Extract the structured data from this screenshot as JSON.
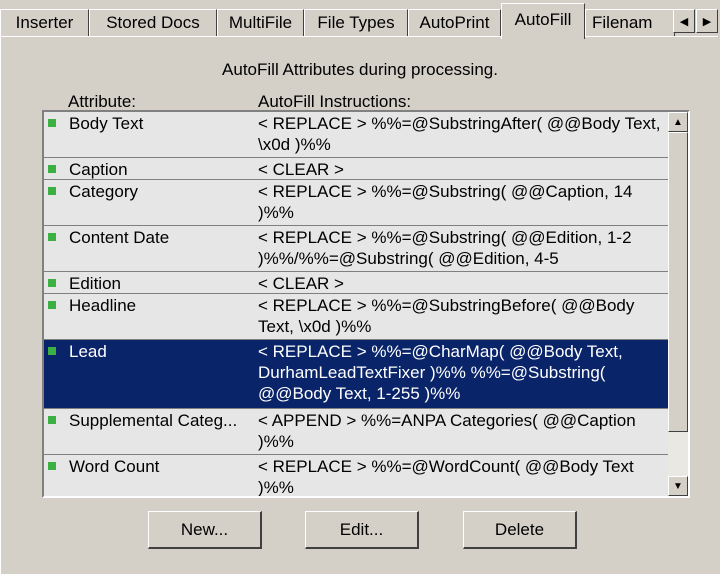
{
  "tabs": [
    {
      "label": "Inserter"
    },
    {
      "label": "Stored Docs"
    },
    {
      "label": "MultiFile"
    },
    {
      "label": "File Types"
    },
    {
      "label": "AutoPrint"
    },
    {
      "label": "AutoFill"
    },
    {
      "label": "Filenam"
    }
  ],
  "active_tab": "AutoFill",
  "tab_scroll": {
    "left_icon": "arrow-left-icon",
    "right_icon": "arrow-right-icon"
  },
  "panel": {
    "heading": "AutoFill Attributes during processing.",
    "columns": {
      "attribute": "Attribute:",
      "instructions": "AutoFill Instructions:"
    }
  },
  "rows": [
    {
      "attribute": "Body Text",
      "instructions": "< REPLACE > %%=@SubstringAfter( @@Body Text, \\x0d )%%",
      "selected": false
    },
    {
      "attribute": "Caption",
      "instructions": "< CLEAR >",
      "selected": false
    },
    {
      "attribute": "Category",
      "instructions": "< REPLACE > %%=@Substring( @@Caption, 14 )%%",
      "selected": false
    },
    {
      "attribute": "Content Date",
      "instructions": "< REPLACE > %%=@Substring( @@Edition, 1-2 )%%/%%=@Substring( @@Edition, 4-5",
      "selected": false
    },
    {
      "attribute": "Edition",
      "instructions": "< CLEAR >",
      "selected": false
    },
    {
      "attribute": "Headline",
      "instructions": "< REPLACE > %%=@SubstringBefore( @@Body Text, \\x0d )%%",
      "selected": false
    },
    {
      "attribute": "Lead",
      "instructions": "< REPLACE > %%=@CharMap( @@Body Text, DurhamLeadTextFixer )%% %%=@Substring( @@Body Text, 1-255 )%%",
      "selected": true
    },
    {
      "attribute": "Supplemental Categ...",
      "instructions": "< APPEND > %%=ANPA Categories( @@Caption )%%",
      "selected": false
    },
    {
      "attribute": "Word Count",
      "instructions": "< REPLACE > %%=@WordCount( @@Body Text )%%",
      "selected": false
    }
  ],
  "buttons": {
    "new": "New...",
    "edit": "Edit...",
    "delete": "Delete"
  },
  "colors": {
    "selection": "#0a246a",
    "marker": "#3cb043",
    "face": "#d4d0c8"
  }
}
